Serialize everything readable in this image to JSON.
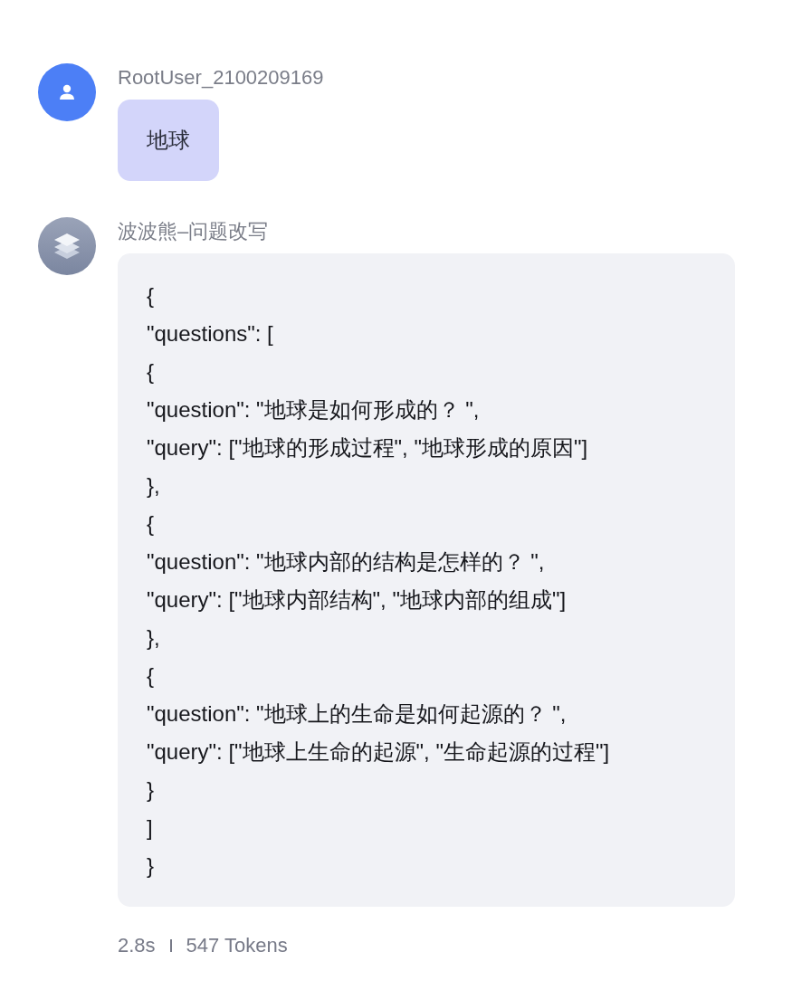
{
  "messages": [
    {
      "kind": "user",
      "author": "RootUser_2100209169",
      "text": "地球"
    },
    {
      "kind": "bot",
      "author": "波波熊–问题改写",
      "lines": [
        "{",
        "\"questions\": [",
        "{",
        "\"question\": \"地球是如何形成的？ \",",
        "\"query\": [\"地球的形成过程\", \"地球形成的原因\"]",
        "},",
        "{",
        "\"question\": \"地球内部的结构是怎样的？ \",",
        "\"query\": [\"地球内部结构\", \"地球内部的组成\"]",
        "},",
        "{",
        "\"question\": \"地球上的生命是如何起源的？ \",",
        "\"query\": [\"地球上生命的起源\", \"生命起源的过程\"]",
        "}",
        "]",
        "}"
      ]
    }
  ],
  "footer": {
    "duration": "2.8s",
    "tokens": "547 Tokens"
  }
}
